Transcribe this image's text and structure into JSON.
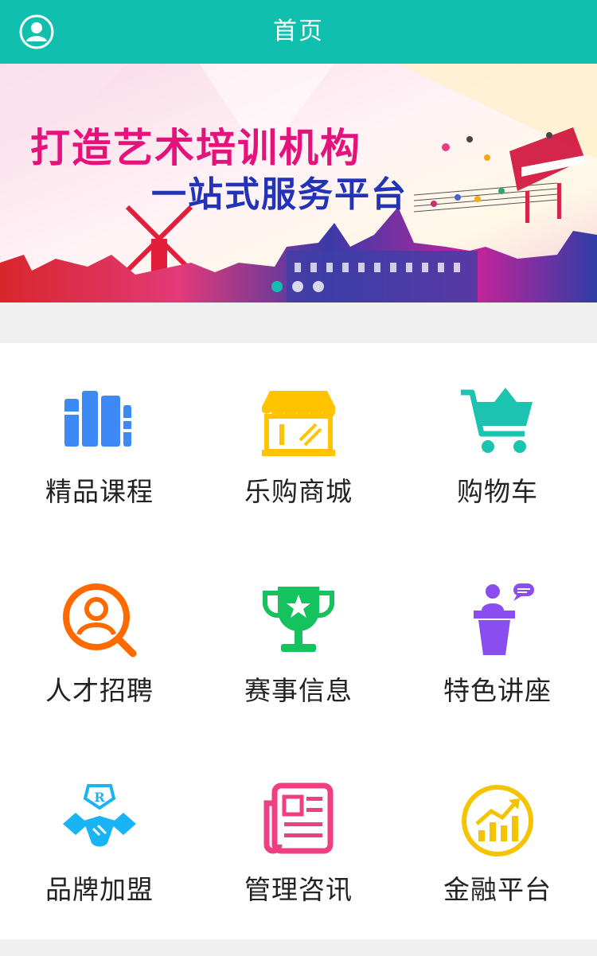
{
  "header": {
    "title": "首页",
    "avatar_icon": "user-avatar-icon"
  },
  "banner": {
    "headline_line1": "打造艺术培训机构",
    "headline_line2": "一站式服务平台",
    "slide_count": 3,
    "active_slide": 1
  },
  "menu": [
    {
      "label": "精品课程",
      "icon": "books-icon",
      "color": "#3d8af7"
    },
    {
      "label": "乐购商城",
      "icon": "storefront-icon",
      "color": "#ffc300"
    },
    {
      "label": "购物车",
      "icon": "shopping-cart-icon",
      "color": "#1cc3b0"
    },
    {
      "label": "人才招聘",
      "icon": "person-search-icon",
      "color": "#ff6a00"
    },
    {
      "label": "赛事信息",
      "icon": "trophy-icon",
      "color": "#15c25d"
    },
    {
      "label": "特色讲座",
      "icon": "lecture-podium-icon",
      "color": "#8a4df0"
    },
    {
      "label": "品牌加盟",
      "icon": "handshake-brand-icon",
      "color": "#19b4f5"
    },
    {
      "label": "管理咨讯",
      "icon": "newspaper-icon",
      "color": "#ee3f83"
    },
    {
      "label": "金融平台",
      "icon": "finance-growth-icon",
      "color": "#f5c400"
    }
  ]
}
